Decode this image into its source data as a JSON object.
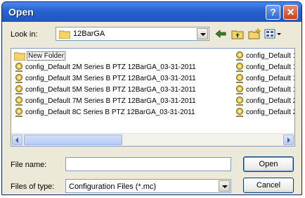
{
  "window": {
    "title": "Open"
  },
  "titlebar": {
    "help_label": "?",
    "close_label": "✕"
  },
  "toolbar": {
    "lookin_label": "Look in:",
    "lookin_value": "12BarGA"
  },
  "files": {
    "left": [
      "New Folder",
      "config_Default 2M Series B PTZ 12BarGA_03-31-2011",
      "config_Default 3M Series B PTZ 12BarGA_03-31-2011",
      "config_Default 5M Series B PTZ 12BarGA_03-31-2011",
      "config_Default 7M Series B PTZ 12BarGA_03-31-2011",
      "config_Default 8C Series B PTZ 12BarGA_03-31-2011"
    ],
    "right": [
      "config_Default 1",
      "config_Default 1",
      "config_Default 1",
      "config_Default 1",
      "config_Default 2",
      "config_Default 2"
    ]
  },
  "form": {
    "filename_label": "File name:",
    "filename_value": "",
    "filetype_label": "Files of type:",
    "filetype_value": "Configuration Files (*.mc)"
  },
  "buttons": {
    "open": "Open",
    "cancel": "Cancel"
  }
}
